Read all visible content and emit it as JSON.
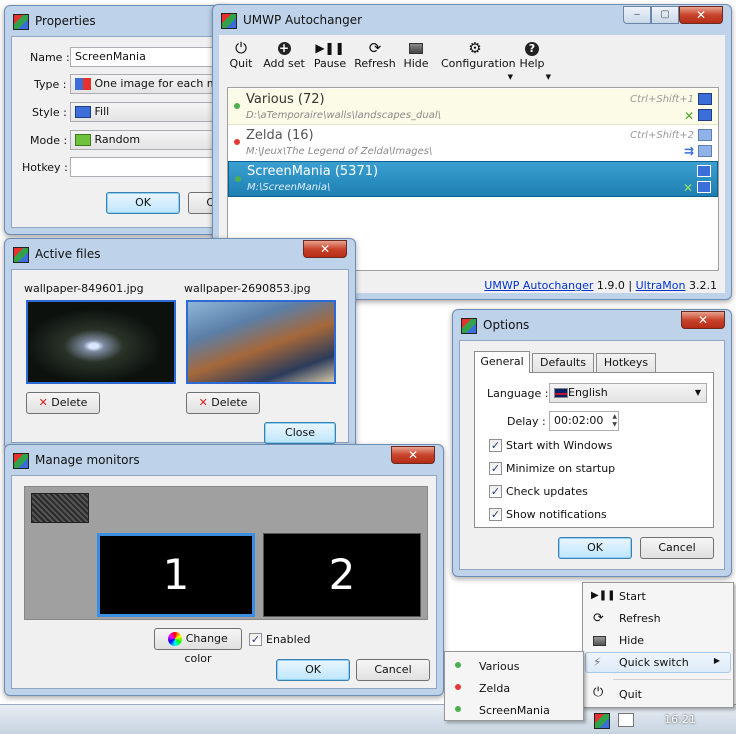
{
  "properties": {
    "title": "Properties",
    "name_label": "Name :",
    "name_value": "ScreenMania",
    "type_label": "Type :",
    "type_value": "One image for each monitor",
    "style_label": "Style :",
    "style_value": "Fill",
    "mode_label": "Mode :",
    "mode_value": "Random",
    "hotkey_label": "Hotkey :",
    "hotkey_value": "",
    "ok": "OK",
    "cancel": "Cancel"
  },
  "main": {
    "title": "UMWP Autochanger",
    "toolbar": [
      {
        "label": "Quit",
        "icon": "power-icon"
      },
      {
        "label": "Add set",
        "icon": "plus-icon"
      },
      {
        "label": "Pause",
        "icon": "pause-icon"
      },
      {
        "label": "Refresh",
        "icon": "refresh-icon"
      },
      {
        "label": "Hide",
        "icon": "hide-icon"
      },
      {
        "label": "Configuration",
        "icon": "gear-icon"
      },
      {
        "label": "Help",
        "icon": "help-icon"
      }
    ],
    "sets": [
      {
        "name": "Various (72)",
        "path": "D:\\aTemporaire\\walls\\landscapes_dual\\",
        "hotkey": "Ctrl+Shift+1",
        "state": "active",
        "dot": "#4caf50"
      },
      {
        "name": "Zelda (16)",
        "path": "M:\\Jeux\\The Legend of Zelda\\Images\\",
        "hotkey": "Ctrl+Shift+2",
        "state": "inactive",
        "dot": "#e53935"
      },
      {
        "name": "ScreenMania (5371)",
        "path": "M:\\ScreenMania\\",
        "hotkey": "",
        "state": "selected",
        "dot": "#4caf50"
      }
    ],
    "footer": {
      "app_link": "UMWP Autochanger",
      "app_version": "1.9.0",
      "sep": "|",
      "ultramon_link": "UltraMon",
      "ultramon_version": "3.2.1"
    }
  },
  "active_files": {
    "title": "Active files",
    "files": [
      {
        "name": "wallpaper-849601.jpg",
        "delete": "Delete"
      },
      {
        "name": "wallpaper-2690853.jpg",
        "delete": "Delete"
      }
    ],
    "close": "Close"
  },
  "options": {
    "title": "Options",
    "tabs": [
      "General",
      "Defaults",
      "Hotkeys"
    ],
    "language_label": "Language :",
    "language_value": "English",
    "delay_label": "Delay :",
    "delay_value": "00:02:00",
    "checks": [
      {
        "label": "Start with Windows",
        "checked": true
      },
      {
        "label": "Minimize on startup",
        "checked": true
      },
      {
        "label": "Check updates",
        "checked": true
      },
      {
        "label": "Show notifications",
        "checked": true
      }
    ],
    "ok": "OK",
    "cancel": "Cancel"
  },
  "monitors": {
    "title": "Manage monitors",
    "monitor1": "1",
    "monitor2": "2",
    "change_color": "Change color",
    "enabled_label": "Enabled",
    "enabled": true,
    "ok": "OK",
    "cancel": "Cancel"
  },
  "tray_menu": {
    "items": [
      "Start",
      "Refresh",
      "Hide",
      "Quick switch",
      "Quit"
    ],
    "submenu": [
      {
        "label": "Various",
        "dot": "#4caf50"
      },
      {
        "label": "Zelda",
        "dot": "#e53935"
      },
      {
        "label": "ScreenMania",
        "dot": "#4caf50"
      }
    ]
  },
  "taskbar": {
    "time": "16:21"
  }
}
